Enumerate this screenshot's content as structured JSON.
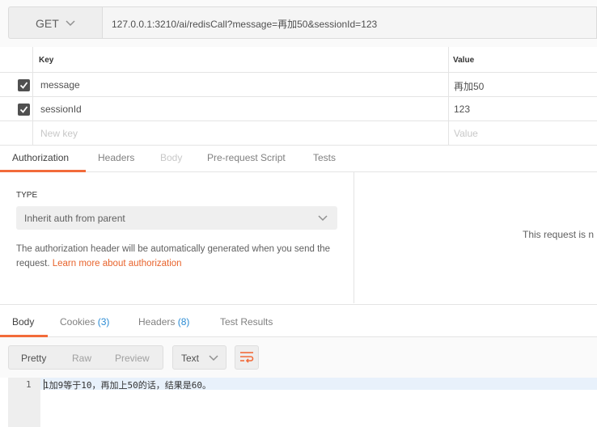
{
  "request": {
    "method": "GET",
    "url": "127.0.0.1:3210/ai/redisCall?message=再加50&sessionId=123"
  },
  "params": {
    "key_header": "Key",
    "value_header": "Value",
    "rows": [
      {
        "key": "message",
        "value": "再加50",
        "checked": true
      },
      {
        "key": "sessionId",
        "value": "123",
        "checked": true
      }
    ],
    "new_key_placeholder": "New key",
    "new_value_placeholder": "Value"
  },
  "request_tabs": [
    "Authorization",
    "Headers",
    "Body",
    "Pre-request Script",
    "Tests"
  ],
  "auth": {
    "type_label": "TYPE",
    "type_value": "Inherit auth from parent",
    "description": "The authorization header will be automatically generated when you send the request. ",
    "learn_more": "Learn more about authorization",
    "right_text": "This request is n"
  },
  "response_tabs": {
    "body": "Body",
    "cookies": "Cookies",
    "cookies_count": "(3)",
    "headers": "Headers",
    "headers_count": "(8)",
    "test_results": "Test Results"
  },
  "view_modes": [
    "Pretty",
    "Raw",
    "Preview"
  ],
  "format": "Text",
  "editor": {
    "line_number": "1",
    "line_text": "1加9等于10，再加上50的话，结果是60。"
  },
  "colors": {
    "accent": "#f26b3a",
    "link": "#e8632c",
    "count": "#2a8bd4"
  }
}
